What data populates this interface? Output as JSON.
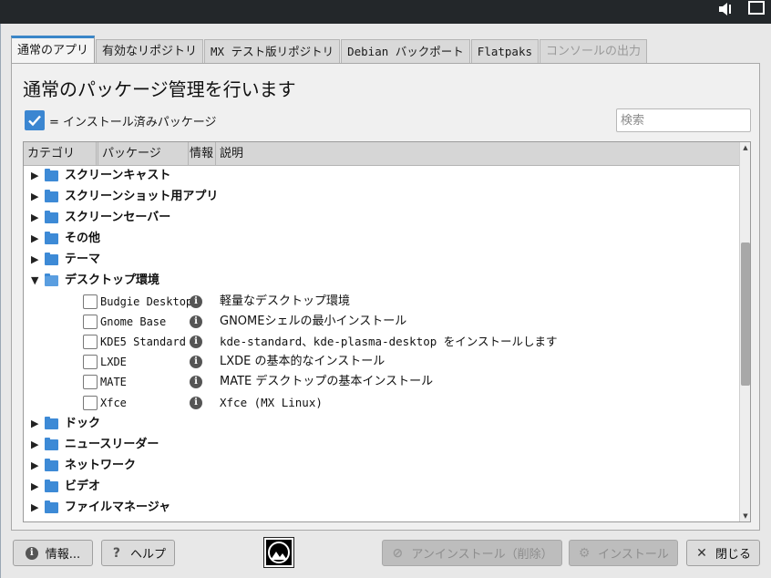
{
  "topbar": {
    "speaker_icon": "speaker-icon",
    "window_icon": "window-icon"
  },
  "tabs": [
    {
      "label": "通常のアプリ",
      "state": "active"
    },
    {
      "label": "有効なリポジトリ",
      "state": "normal"
    },
    {
      "label": "MX テスト版リポジトリ",
      "state": "normal"
    },
    {
      "label": "Debian バックポート",
      "state": "normal"
    },
    {
      "label": "Flatpaks",
      "state": "normal"
    },
    {
      "label": "コンソールの出力",
      "state": "disabled"
    }
  ],
  "heading": "通常のパッケージ管理を行います",
  "legend": {
    "text": "= インストール済みパッケージ"
  },
  "search": {
    "placeholder": "検索",
    "value": ""
  },
  "tree": {
    "columns": [
      "カテゴリ",
      "パッケージ",
      "情報",
      "説明"
    ],
    "rows": [
      {
        "kind": "category",
        "expanded": false,
        "label": "スクリーンキャスト"
      },
      {
        "kind": "category",
        "expanded": false,
        "label": "スクリーンショット用アプリ"
      },
      {
        "kind": "category",
        "expanded": false,
        "label": "スクリーンセーバー"
      },
      {
        "kind": "category",
        "expanded": false,
        "label": "その他"
      },
      {
        "kind": "category",
        "expanded": false,
        "label": "テーマ"
      },
      {
        "kind": "category",
        "expanded": true,
        "label": "デスクトップ環境"
      },
      {
        "kind": "package",
        "name": "Budgie Desktop",
        "description": "軽量なデスクトップ環境",
        "checked": false
      },
      {
        "kind": "package",
        "name": "Gnome Base",
        "description": "GNOMEシェルの最小インストール",
        "checked": false
      },
      {
        "kind": "package",
        "name": "KDE5 Standard",
        "description": "kde-standard、kde-plasma-desktop をインストールします",
        "checked": false
      },
      {
        "kind": "package",
        "name": "LXDE",
        "description": "LXDE の基本的なインストール",
        "checked": false
      },
      {
        "kind": "package",
        "name": "MATE",
        "description": "MATE デスクトップの基本インストール",
        "checked": false
      },
      {
        "kind": "package",
        "name": "Xfce",
        "description": "Xfce (MX Linux)",
        "checked": false
      },
      {
        "kind": "category",
        "expanded": false,
        "label": "ドック"
      },
      {
        "kind": "category",
        "expanded": false,
        "label": "ニュースリーダー"
      },
      {
        "kind": "category",
        "expanded": false,
        "label": "ネットワーク"
      },
      {
        "kind": "category",
        "expanded": false,
        "label": "ビデオ"
      },
      {
        "kind": "category",
        "expanded": false,
        "label": "ファイルマネージャ"
      }
    ]
  },
  "buttons": {
    "about": "情報...",
    "help": "ヘルプ",
    "uninstall": "アンインストール（削除）",
    "install": "インストール",
    "close": "閉じる"
  },
  "colors": {
    "accent": "#3b86d1",
    "folder": "#3d8ad6"
  }
}
